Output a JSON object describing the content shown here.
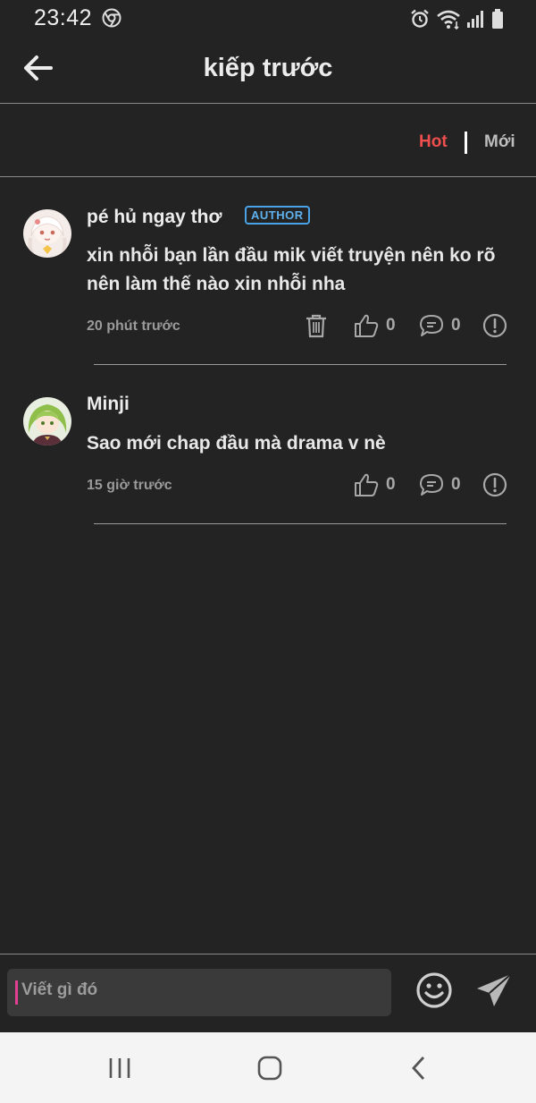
{
  "status_bar": {
    "time": "23:42"
  },
  "header": {
    "title": "kiếp trước"
  },
  "sort": {
    "hot_label": "Hot",
    "new_label": "Mới",
    "active": "Hot"
  },
  "comments": [
    {
      "author": "pé hủ ngay thơ",
      "badge": "AUTHOR",
      "text": "xin nhỗi bạn lần đầu mik viết truyện nên ko rõ nên làm thế nào xin nhỗi nha",
      "time": "20 phút trước",
      "likes": "0",
      "replies": "0",
      "can_delete": true
    },
    {
      "author": "Minji",
      "text": "Sao mới chap đầu mà drama v nè",
      "time": "15 giờ trước",
      "likes": "0",
      "replies": "0",
      "can_delete": false
    }
  ],
  "composer": {
    "placeholder": "Viết gì đó"
  },
  "colors": {
    "accent_hot": "#ef4e4e",
    "badge_blue": "#4aa3e6",
    "background": "#232323",
    "caret_pink": "#e0408f"
  },
  "icons": [
    "back-arrow-icon",
    "trash-icon",
    "thumbs-up-icon",
    "comment-icon",
    "report-icon",
    "emoji-icon",
    "send-icon",
    "alarm-icon",
    "wifi-icon",
    "signal-icon",
    "battery-icon",
    "chrome-icon"
  ]
}
